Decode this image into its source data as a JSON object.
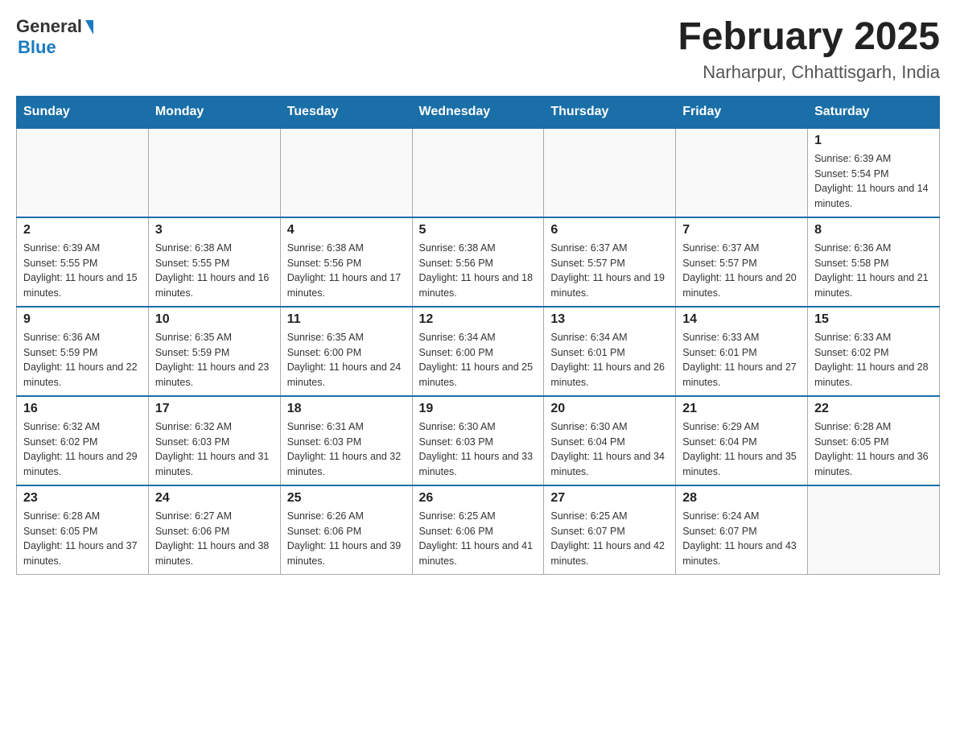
{
  "header": {
    "logo_general": "General",
    "logo_blue": "Blue",
    "month_title": "February 2025",
    "location": "Narharpur, Chhattisgarh, India"
  },
  "weekdays": [
    "Sunday",
    "Monday",
    "Tuesday",
    "Wednesday",
    "Thursday",
    "Friday",
    "Saturday"
  ],
  "weeks": [
    [
      {
        "day": "",
        "info": ""
      },
      {
        "day": "",
        "info": ""
      },
      {
        "day": "",
        "info": ""
      },
      {
        "day": "",
        "info": ""
      },
      {
        "day": "",
        "info": ""
      },
      {
        "day": "",
        "info": ""
      },
      {
        "day": "1",
        "info": "Sunrise: 6:39 AM\nSunset: 5:54 PM\nDaylight: 11 hours and 14 minutes."
      }
    ],
    [
      {
        "day": "2",
        "info": "Sunrise: 6:39 AM\nSunset: 5:55 PM\nDaylight: 11 hours and 15 minutes."
      },
      {
        "day": "3",
        "info": "Sunrise: 6:38 AM\nSunset: 5:55 PM\nDaylight: 11 hours and 16 minutes."
      },
      {
        "day": "4",
        "info": "Sunrise: 6:38 AM\nSunset: 5:56 PM\nDaylight: 11 hours and 17 minutes."
      },
      {
        "day": "5",
        "info": "Sunrise: 6:38 AM\nSunset: 5:56 PM\nDaylight: 11 hours and 18 minutes."
      },
      {
        "day": "6",
        "info": "Sunrise: 6:37 AM\nSunset: 5:57 PM\nDaylight: 11 hours and 19 minutes."
      },
      {
        "day": "7",
        "info": "Sunrise: 6:37 AM\nSunset: 5:57 PM\nDaylight: 11 hours and 20 minutes."
      },
      {
        "day": "8",
        "info": "Sunrise: 6:36 AM\nSunset: 5:58 PM\nDaylight: 11 hours and 21 minutes."
      }
    ],
    [
      {
        "day": "9",
        "info": "Sunrise: 6:36 AM\nSunset: 5:59 PM\nDaylight: 11 hours and 22 minutes."
      },
      {
        "day": "10",
        "info": "Sunrise: 6:35 AM\nSunset: 5:59 PM\nDaylight: 11 hours and 23 minutes."
      },
      {
        "day": "11",
        "info": "Sunrise: 6:35 AM\nSunset: 6:00 PM\nDaylight: 11 hours and 24 minutes."
      },
      {
        "day": "12",
        "info": "Sunrise: 6:34 AM\nSunset: 6:00 PM\nDaylight: 11 hours and 25 minutes."
      },
      {
        "day": "13",
        "info": "Sunrise: 6:34 AM\nSunset: 6:01 PM\nDaylight: 11 hours and 26 minutes."
      },
      {
        "day": "14",
        "info": "Sunrise: 6:33 AM\nSunset: 6:01 PM\nDaylight: 11 hours and 27 minutes."
      },
      {
        "day": "15",
        "info": "Sunrise: 6:33 AM\nSunset: 6:02 PM\nDaylight: 11 hours and 28 minutes."
      }
    ],
    [
      {
        "day": "16",
        "info": "Sunrise: 6:32 AM\nSunset: 6:02 PM\nDaylight: 11 hours and 29 minutes."
      },
      {
        "day": "17",
        "info": "Sunrise: 6:32 AM\nSunset: 6:03 PM\nDaylight: 11 hours and 31 minutes."
      },
      {
        "day": "18",
        "info": "Sunrise: 6:31 AM\nSunset: 6:03 PM\nDaylight: 11 hours and 32 minutes."
      },
      {
        "day": "19",
        "info": "Sunrise: 6:30 AM\nSunset: 6:03 PM\nDaylight: 11 hours and 33 minutes."
      },
      {
        "day": "20",
        "info": "Sunrise: 6:30 AM\nSunset: 6:04 PM\nDaylight: 11 hours and 34 minutes."
      },
      {
        "day": "21",
        "info": "Sunrise: 6:29 AM\nSunset: 6:04 PM\nDaylight: 11 hours and 35 minutes."
      },
      {
        "day": "22",
        "info": "Sunrise: 6:28 AM\nSunset: 6:05 PM\nDaylight: 11 hours and 36 minutes."
      }
    ],
    [
      {
        "day": "23",
        "info": "Sunrise: 6:28 AM\nSunset: 6:05 PM\nDaylight: 11 hours and 37 minutes."
      },
      {
        "day": "24",
        "info": "Sunrise: 6:27 AM\nSunset: 6:06 PM\nDaylight: 11 hours and 38 minutes."
      },
      {
        "day": "25",
        "info": "Sunrise: 6:26 AM\nSunset: 6:06 PM\nDaylight: 11 hours and 39 minutes."
      },
      {
        "day": "26",
        "info": "Sunrise: 6:25 AM\nSunset: 6:06 PM\nDaylight: 11 hours and 41 minutes."
      },
      {
        "day": "27",
        "info": "Sunrise: 6:25 AM\nSunset: 6:07 PM\nDaylight: 11 hours and 42 minutes."
      },
      {
        "day": "28",
        "info": "Sunrise: 6:24 AM\nSunset: 6:07 PM\nDaylight: 11 hours and 43 minutes."
      },
      {
        "day": "",
        "info": ""
      }
    ]
  ]
}
